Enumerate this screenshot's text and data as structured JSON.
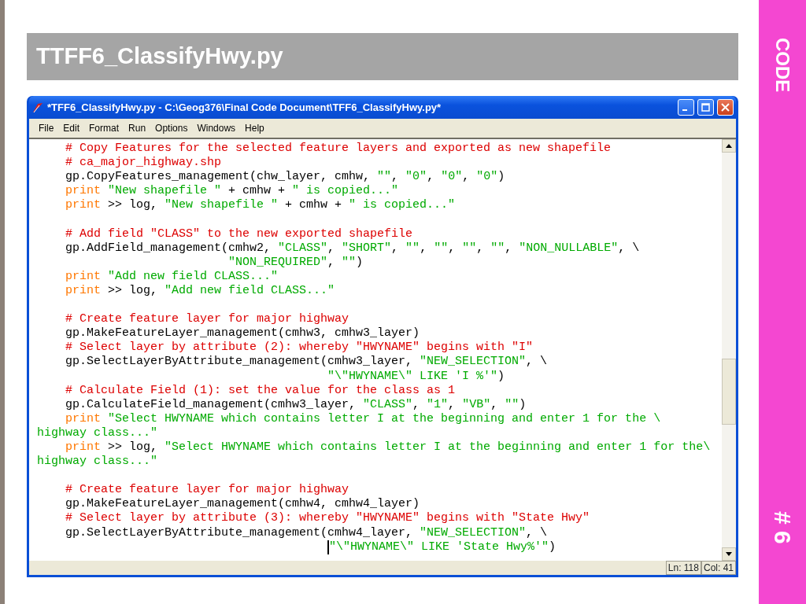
{
  "slide": {
    "title": "TTFF6_ClassifyHwy.py",
    "side_label": "CODE",
    "slide_number": "# 6"
  },
  "window": {
    "title": "*TFF6_ClassifyHwy.py - C:\\Geog376\\Final Code Document\\TFF6_ClassifyHwy.py*",
    "menu": [
      "File",
      "Edit",
      "Format",
      "Run",
      "Options",
      "Windows",
      "Help"
    ],
    "code_lines": [
      {
        "kind": "indented",
        "segments": [
          {
            "kind": "comment",
            "text": "# Copy Features for the selected feature layers and exported as new shapefile"
          }
        ]
      },
      {
        "kind": "indented",
        "segments": [
          {
            "kind": "comment",
            "text": "# ca_major_highway.shp"
          }
        ]
      },
      {
        "kind": "indented",
        "segments": [
          {
            "kind": "plain",
            "text": "gp.CopyFeatures_management(chw_layer, cmhw, "
          },
          {
            "kind": "string",
            "text": "\"\""
          },
          {
            "kind": "plain",
            "text": ", "
          },
          {
            "kind": "string",
            "text": "\"0\""
          },
          {
            "kind": "plain",
            "text": ", "
          },
          {
            "kind": "string",
            "text": "\"0\""
          },
          {
            "kind": "plain",
            "text": ", "
          },
          {
            "kind": "string",
            "text": "\"0\""
          },
          {
            "kind": "plain",
            "text": ")"
          }
        ]
      },
      {
        "kind": "indented",
        "segments": [
          {
            "kind": "keyword",
            "text": "print"
          },
          {
            "kind": "string",
            "text": " \"New shapefile \""
          },
          {
            "kind": "plain",
            "text": " + cmhw + "
          },
          {
            "kind": "string",
            "text": "\" is copied...\""
          }
        ]
      },
      {
        "kind": "indented",
        "segments": [
          {
            "kind": "keyword",
            "text": "print"
          },
          {
            "kind": "plain",
            "text": " >> log, "
          },
          {
            "kind": "string",
            "text": "\"New shapefile \""
          },
          {
            "kind": "plain",
            "text": " + cmhw + "
          },
          {
            "kind": "string",
            "text": "\" is copied...\""
          }
        ]
      },
      {
        "kind": "blank"
      },
      {
        "kind": "indented",
        "segments": [
          {
            "kind": "comment",
            "text": "# Add field \"CLASS\" to the new exported shapefile"
          }
        ]
      },
      {
        "kind": "indented",
        "segments": [
          {
            "kind": "plain",
            "text": "gp.AddField_management(cmhw2, "
          },
          {
            "kind": "string",
            "text": "\"CLASS\""
          },
          {
            "kind": "plain",
            "text": ", "
          },
          {
            "kind": "string",
            "text": "\"SHORT\""
          },
          {
            "kind": "plain",
            "text": ", "
          },
          {
            "kind": "string",
            "text": "\"\""
          },
          {
            "kind": "plain",
            "text": ", "
          },
          {
            "kind": "string",
            "text": "\"\""
          },
          {
            "kind": "plain",
            "text": ", "
          },
          {
            "kind": "string",
            "text": "\"\""
          },
          {
            "kind": "plain",
            "text": ", "
          },
          {
            "kind": "string",
            "text": "\"\""
          },
          {
            "kind": "plain",
            "text": ", "
          },
          {
            "kind": "string",
            "text": "\"NON_NULLABLE\""
          },
          {
            "kind": "plain",
            "text": ", \\"
          }
        ]
      },
      {
        "kind": "argument_continuation",
        "segments": [
          {
            "kind": "string",
            "text": "\"NON_REQUIRED\""
          },
          {
            "kind": "plain",
            "text": ", "
          },
          {
            "kind": "string",
            "text": "\"\""
          },
          {
            "kind": "plain",
            "text": ")"
          }
        ]
      },
      {
        "kind": "indented",
        "segments": [
          {
            "kind": "keyword",
            "text": "print"
          },
          {
            "kind": "string",
            "text": " \"Add new field CLASS...\""
          }
        ]
      },
      {
        "kind": "indented",
        "segments": [
          {
            "kind": "keyword",
            "text": "print"
          },
          {
            "kind": "plain",
            "text": " >> log, "
          },
          {
            "kind": "string",
            "text": "\"Add new field CLASS...\""
          }
        ]
      },
      {
        "kind": "blank"
      },
      {
        "kind": "indented",
        "segments": [
          {
            "kind": "comment",
            "text": "# Create feature layer for major highway"
          }
        ]
      },
      {
        "kind": "indented",
        "segments": [
          {
            "kind": "plain",
            "text": "gp.MakeFeatureLayer_management(cmhw3, cmhw3_layer)"
          }
        ]
      },
      {
        "kind": "indented",
        "segments": [
          {
            "kind": "comment",
            "text": "# Select layer by attribute (2): whereby \"HWYNAME\" begins with \"I\""
          }
        ]
      },
      {
        "kind": "indented",
        "segments": [
          {
            "kind": "plain",
            "text": "gp.SelectLayerByAttribute_management(cmhw3_layer, "
          },
          {
            "kind": "string",
            "text": "\"NEW_SELECTION\""
          },
          {
            "kind": "plain",
            "text": ", \\"
          }
        ]
      },
      {
        "kind": "where_continuation",
        "segments": [
          {
            "kind": "string",
            "text": "\"\\\"HWYNAME\\\" LIKE 'I %'\""
          },
          {
            "kind": "plain",
            "text": ")"
          }
        ]
      },
      {
        "kind": "indented",
        "segments": [
          {
            "kind": "comment",
            "text": "# Calculate Field (1): set the value for the class as 1"
          }
        ]
      },
      {
        "kind": "indented",
        "segments": [
          {
            "kind": "plain",
            "text": "gp.CalculateField_management(cmhw3_layer, "
          },
          {
            "kind": "string",
            "text": "\"CLASS\""
          },
          {
            "kind": "plain",
            "text": ", "
          },
          {
            "kind": "string",
            "text": "\"1\""
          },
          {
            "kind": "plain",
            "text": ", "
          },
          {
            "kind": "string",
            "text": "\"VB\""
          },
          {
            "kind": "plain",
            "text": ", "
          },
          {
            "kind": "string",
            "text": "\"\""
          },
          {
            "kind": "plain",
            "text": ")"
          }
        ]
      },
      {
        "kind": "indented",
        "segments": [
          {
            "kind": "keyword",
            "text": "print"
          },
          {
            "kind": "string",
            "text": " \"Select HWYNAME which contains letter I at the beginning and enter 1 for the \\"
          }
        ]
      },
      {
        "kind": "wrapped",
        "segments": [
          {
            "kind": "string",
            "text": "highway class...\""
          }
        ]
      },
      {
        "kind": "indented",
        "segments": [
          {
            "kind": "keyword",
            "text": "print"
          },
          {
            "kind": "plain",
            "text": " >> log, "
          },
          {
            "kind": "string",
            "text": "\"Select HWYNAME which contains letter I at the beginning and enter 1 for the\\"
          }
        ]
      },
      {
        "kind": "wrapped",
        "segments": [
          {
            "kind": "string",
            "text": "highway class...\""
          }
        ]
      },
      {
        "kind": "blank"
      },
      {
        "kind": "indented",
        "segments": [
          {
            "kind": "comment",
            "text": "# Create feature layer for major highway"
          }
        ]
      },
      {
        "kind": "indented",
        "segments": [
          {
            "kind": "plain",
            "text": "gp.MakeFeatureLayer_management(cmhw4, cmhw4_layer)"
          }
        ]
      },
      {
        "kind": "indented",
        "segments": [
          {
            "kind": "comment",
            "text": "# Select layer by attribute (3): whereby \"HWYNAME\" begins with \"State Hwy\""
          }
        ]
      },
      {
        "kind": "indented",
        "segments": [
          {
            "kind": "plain",
            "text": "gp.SelectLayerByAttribute_management(cmhw4_layer, "
          },
          {
            "kind": "string",
            "text": "\"NEW_SELECTION\""
          },
          {
            "kind": "plain",
            "text": ", \\"
          }
        ]
      },
      {
        "kind": "where_continuation",
        "segments": [
          {
            "kind": "string",
            "text": "\"\\\"HWYNAME\\\" LIKE 'State Hwy%'\"",
            "cursor": true
          },
          {
            "kind": "plain",
            "text": ")"
          }
        ]
      }
    ],
    "status_bar": {
      "line": "Ln: 118",
      "column": "Col: 41"
    }
  }
}
